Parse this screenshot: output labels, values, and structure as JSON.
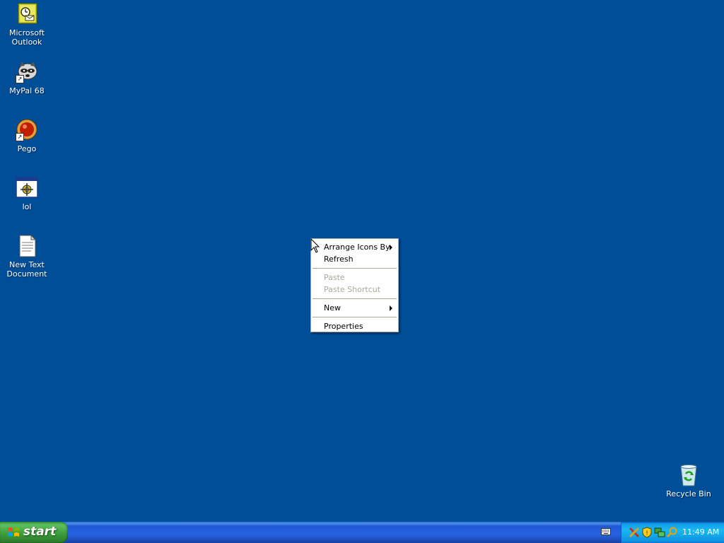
{
  "desktop": {
    "background_color": "#004e98",
    "icons": [
      {
        "label_line1": "Microsoft",
        "label_line2": "Outlook",
        "icon": "outlook-icon"
      },
      {
        "label_line1": "MyPal 68",
        "label_line2": "",
        "icon": "mypal-icon"
      },
      {
        "label_line1": "Pego",
        "label_line2": "",
        "icon": "pego-icon"
      },
      {
        "label_line1": "lol",
        "label_line2": "",
        "icon": "application-icon"
      },
      {
        "label_line1": "New Text",
        "label_line2": "Document",
        "icon": "text-document-icon"
      }
    ],
    "recycle_bin": {
      "label": "Recycle Bin",
      "icon": "recycle-bin-icon"
    }
  },
  "context_menu": {
    "items": [
      {
        "label": "Arrange Icons By",
        "submenu": true,
        "enabled": true
      },
      {
        "label": "Refresh",
        "submenu": false,
        "enabled": true
      },
      {
        "label": "Paste",
        "submenu": false,
        "enabled": false
      },
      {
        "label": "Paste Shortcut",
        "submenu": false,
        "enabled": false
      },
      {
        "label": "New",
        "submenu": true,
        "enabled": true
      },
      {
        "label": "Properties",
        "submenu": false,
        "enabled": true
      }
    ]
  },
  "taskbar": {
    "start_label": "start",
    "tray_icons": [
      "tools-icon",
      "shield-icon",
      "network-icon",
      "search-icon"
    ],
    "clock": "11:49 AM"
  }
}
